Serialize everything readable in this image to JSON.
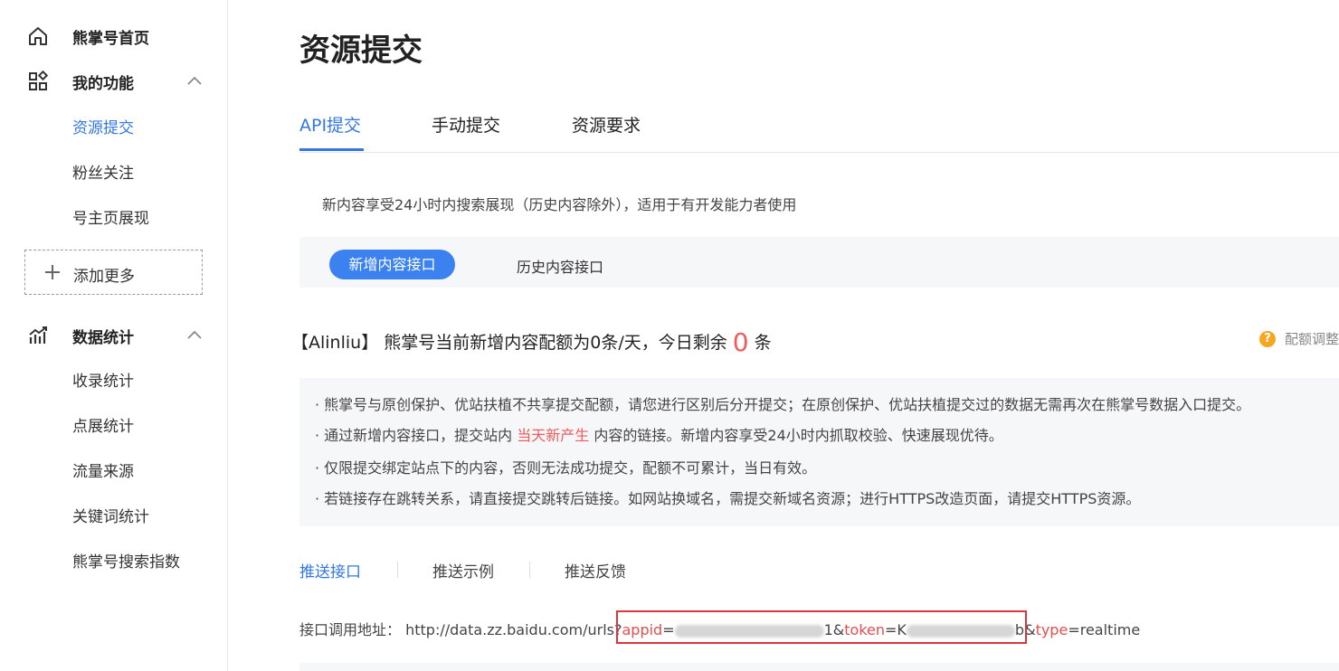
{
  "sidebar": {
    "home_label": "熊掌号首页",
    "my_functions": {
      "label": "我的功能",
      "items": [
        "资源提交",
        "粉丝关注",
        "号主页展现"
      ]
    },
    "add_more_label": "添加更多",
    "data_stats": {
      "label": "数据统计",
      "items": [
        "收录统计",
        "点展统计",
        "流量来源",
        "关键词统计",
        "熊掌号搜索指数"
      ]
    }
  },
  "main": {
    "title": "资源提交",
    "tabs": [
      "API提交",
      "手动提交",
      "资源要求"
    ],
    "description": "新内容享受24小时内搜索展现（历史内容除外），适用于有开发能力者使用",
    "interface_toggle": {
      "active": "新增内容接口",
      "inactive": "历史内容接口"
    },
    "quota": {
      "prefix": "【Alinliu】 熊掌号当前新增内容配额为0条/天，今日剩余",
      "remaining": "0",
      "suffix": "条"
    },
    "help_text": "配额调整",
    "notes": {
      "n1": "· 熊掌号与原创保护、优站扶植不共享提交配额，请您进行区别后分开提交；在原创保护、优站扶植提交过的数据无需再次在熊掌号数据入口提交。",
      "n2_prefix": "· 通过新增内容接口，提交站内",
      "n2_highlight": "当天新产生",
      "n2_suffix": "内容的链接。新增内容享受24小时内抓取校验、快速展现优待。",
      "n3": "· 仅限提交绑定站点下的内容，否则无法成功提交，配额不可累计，当日有效。",
      "n4": "· 若链接存在跳转关系，请直接提交跳转后链接。如网站换域名，需提交新域名资源；进行HTTPS改造页面，请提交HTTPS资源。"
    },
    "push_tabs": [
      "推送接口",
      "推送示例",
      "推送反馈"
    ],
    "api": {
      "label": "接口调用地址：",
      "base": "http://data.zz.baidu.com/urls",
      "q": "?",
      "p1": "appid",
      "eq": "=",
      "v1_end": "1&",
      "p2": "token",
      "v2_start": "K",
      "v2_end": "b&",
      "p3_part": "type",
      "v3": "=realtime"
    }
  },
  "colors": {
    "accent": "#3377e0",
    "highlight": "#f05a5a",
    "box": "#d9363e"
  }
}
